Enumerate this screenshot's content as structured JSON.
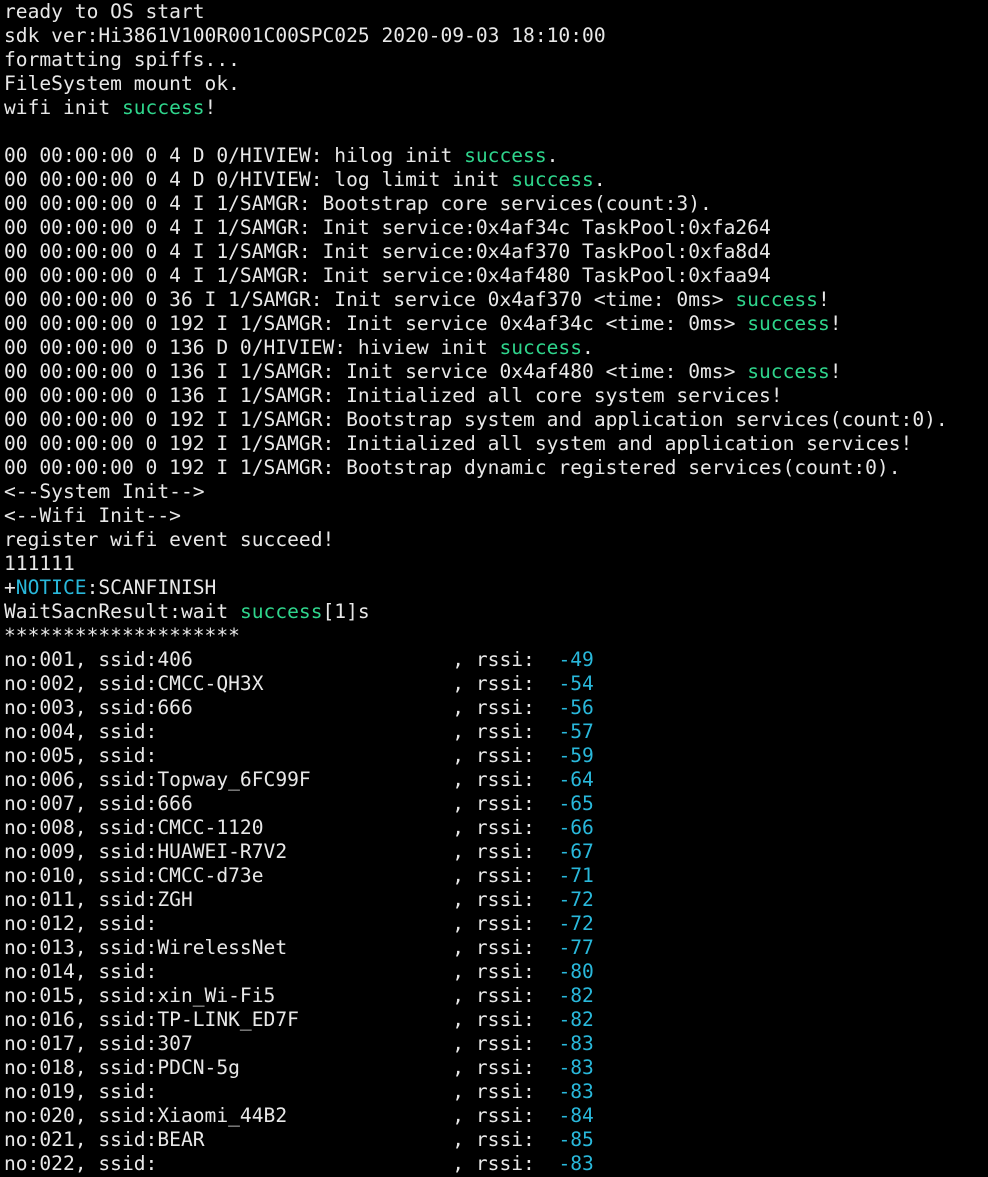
{
  "colors": {
    "background": "#000000",
    "text": "#e8e8e8",
    "success": "#2fd58c",
    "notice": "#29b8db",
    "rssi": "#29b8db"
  },
  "terminal": {
    "lines": [
      [
        {
          "t": "ready to OS start"
        }
      ],
      [
        {
          "t": "sdk ver:Hi3861V100R001C00SPC025 2020-09-03 18:10:00"
        }
      ],
      [
        {
          "t": "formatting spiffs..."
        }
      ],
      [
        {
          "t": "FileSystem mount ok."
        }
      ],
      [
        {
          "t": "wifi init "
        },
        {
          "t": "success",
          "c": "green"
        },
        {
          "t": "!"
        }
      ],
      [],
      [
        {
          "t": "00 00:00:00 0 4 D 0/HIVIEW: hilog init "
        },
        {
          "t": "success",
          "c": "green"
        },
        {
          "t": "."
        }
      ],
      [
        {
          "t": "00 00:00:00 0 4 D 0/HIVIEW: log limit init "
        },
        {
          "t": "success",
          "c": "green"
        },
        {
          "t": "."
        }
      ],
      [
        {
          "t": "00 00:00:00 0 4 I 1/SAMGR: Bootstrap core services(count:3)."
        }
      ],
      [
        {
          "t": "00 00:00:00 0 4 I 1/SAMGR: Init service:0x4af34c TaskPool:0xfa264"
        }
      ],
      [
        {
          "t": "00 00:00:00 0 4 I 1/SAMGR: Init service:0x4af370 TaskPool:0xfa8d4"
        }
      ],
      [
        {
          "t": "00 00:00:00 0 4 I 1/SAMGR: Init service:0x4af480 TaskPool:0xfaa94"
        }
      ],
      [
        {
          "t": "00 00:00:00 0 36 I 1/SAMGR: Init service 0x4af370 <time: 0ms> "
        },
        {
          "t": "success",
          "c": "green"
        },
        {
          "t": "!"
        }
      ],
      [
        {
          "t": "00 00:00:00 0 192 I 1/SAMGR: Init service 0x4af34c <time: 0ms> "
        },
        {
          "t": "success",
          "c": "green"
        },
        {
          "t": "!"
        }
      ],
      [
        {
          "t": "00 00:00:00 0 136 D 0/HIVIEW: hiview init "
        },
        {
          "t": "success",
          "c": "green"
        },
        {
          "t": "."
        }
      ],
      [
        {
          "t": "00 00:00:00 0 136 I 1/SAMGR: Init service 0x4af480 <time: 0ms> "
        },
        {
          "t": "success",
          "c": "green"
        },
        {
          "t": "!"
        }
      ],
      [
        {
          "t": "00 00:00:00 0 136 I 1/SAMGR: Initialized all core system services!"
        }
      ],
      [
        {
          "t": "00 00:00:00 0 192 I 1/SAMGR: Bootstrap system and application services(count:0)."
        }
      ],
      [
        {
          "t": "00 00:00:00 0 192 I 1/SAMGR: Initialized all system and application services!"
        }
      ],
      [
        {
          "t": "00 00:00:00 0 192 I 1/SAMGR: Bootstrap dynamic registered services(count:0)."
        }
      ],
      [
        {
          "t": "<--System Init-->"
        }
      ],
      [
        {
          "t": "<--Wifi Init-->"
        }
      ],
      [
        {
          "t": "register wifi event succeed!"
        }
      ],
      [
        {
          "t": "111111"
        }
      ],
      [
        {
          "t": "+"
        },
        {
          "t": "NOTICE",
          "c": "cyan"
        },
        {
          "t": ":SCANFINISH"
        }
      ],
      [
        {
          "t": "WaitSacnResult:wait "
        },
        {
          "t": "success",
          "c": "green"
        },
        {
          "t": "[1]s"
        }
      ],
      [
        {
          "t": "********************"
        }
      ],
      [
        {
          "t": "no:001, ssid:406                      , rssi:  "
        },
        {
          "t": "-49",
          "c": "cyan"
        }
      ],
      [
        {
          "t": "no:002, ssid:CMCC-QH3X                , rssi:  "
        },
        {
          "t": "-54",
          "c": "cyan"
        }
      ],
      [
        {
          "t": "no:003, ssid:666                      , rssi:  "
        },
        {
          "t": "-56",
          "c": "cyan"
        }
      ],
      [
        {
          "t": "no:004, ssid:                         , rssi:  "
        },
        {
          "t": "-57",
          "c": "cyan"
        }
      ],
      [
        {
          "t": "no:005, ssid:                         , rssi:  "
        },
        {
          "t": "-59",
          "c": "cyan"
        }
      ],
      [
        {
          "t": "no:006, ssid:Topway_6FC99F            , rssi:  "
        },
        {
          "t": "-64",
          "c": "cyan"
        }
      ],
      [
        {
          "t": "no:007, ssid:666                      , rssi:  "
        },
        {
          "t": "-65",
          "c": "cyan"
        }
      ],
      [
        {
          "t": "no:008, ssid:CMCC-1120                , rssi:  "
        },
        {
          "t": "-66",
          "c": "cyan"
        }
      ],
      [
        {
          "t": "no:009, ssid:HUAWEI-R7V2              , rssi:  "
        },
        {
          "t": "-67",
          "c": "cyan"
        }
      ],
      [
        {
          "t": "no:010, ssid:CMCC-d73e                , rssi:  "
        },
        {
          "t": "-71",
          "c": "cyan"
        }
      ],
      [
        {
          "t": "no:011, ssid:ZGH                      , rssi:  "
        },
        {
          "t": "-72",
          "c": "cyan"
        }
      ],
      [
        {
          "t": "no:012, ssid:                         , rssi:  "
        },
        {
          "t": "-72",
          "c": "cyan"
        }
      ],
      [
        {
          "t": "no:013, ssid:WirelessNet              , rssi:  "
        },
        {
          "t": "-77",
          "c": "cyan"
        }
      ],
      [
        {
          "t": "no:014, ssid:                         , rssi:  "
        },
        {
          "t": "-80",
          "c": "cyan"
        }
      ],
      [
        {
          "t": "no:015, ssid:xin_Wi-Fi5               , rssi:  "
        },
        {
          "t": "-82",
          "c": "cyan"
        }
      ],
      [
        {
          "t": "no:016, ssid:TP-LINK_ED7F             , rssi:  "
        },
        {
          "t": "-82",
          "c": "cyan"
        }
      ],
      [
        {
          "t": "no:017, ssid:307                      , rssi:  "
        },
        {
          "t": "-83",
          "c": "cyan"
        }
      ],
      [
        {
          "t": "no:018, ssid:PDCN-5g                  , rssi:  "
        },
        {
          "t": "-83",
          "c": "cyan"
        }
      ],
      [
        {
          "t": "no:019, ssid:                         , rssi:  "
        },
        {
          "t": "-83",
          "c": "cyan"
        }
      ],
      [
        {
          "t": "no:020, ssid:Xiaomi_44B2              , rssi:  "
        },
        {
          "t": "-84",
          "c": "cyan"
        }
      ],
      [
        {
          "t": "no:021, ssid:BEAR                     , rssi:  "
        },
        {
          "t": "-85",
          "c": "cyan"
        }
      ],
      [
        {
          "t": "no:022, ssid:                         , rssi:  "
        },
        {
          "t": "-83",
          "c": "cyan"
        }
      ]
    ]
  }
}
